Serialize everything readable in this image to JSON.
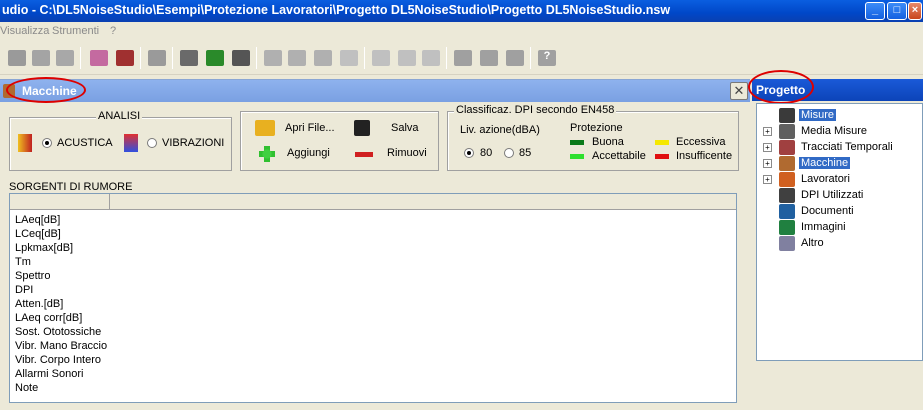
{
  "window": {
    "title": "udio - C:\\DL5NoiseStudio\\Esempi\\Protezione Lavoratori\\Progetto DL5NoiseStudio\\Progetto DL5NoiseStudio.nsw"
  },
  "menu": [
    "Visualizza",
    "Strumenti",
    "?"
  ],
  "macchine": {
    "title": "Macchine",
    "close": "✕",
    "analisi": {
      "label": "ANALISI",
      "acustica": "ACUSTICA",
      "vibrazioni": "VIBRAZIONI",
      "selected": "ACUSTICA"
    },
    "actions": {
      "apri": "Apri File...",
      "salva": "Salva",
      "aggiungi": "Aggiungi",
      "rimuovi": "Rimuovi"
    },
    "dpi": {
      "label": "Classificaz. DPI secondo EN458",
      "liv_label": "Liv. azione(dBA)",
      "opt80": "80",
      "opt85": "85",
      "selected": "80",
      "protezione_label": "Protezione",
      "buona": "Buona",
      "accettabile": "Accettabile",
      "eccessiva": "Eccessiva",
      "insufficente": "Insufficente",
      "colors": {
        "buona": "#0a7a1a",
        "accettabile": "#2ee02e",
        "eccessiva": "#f5e800",
        "insufficente": "#e01010"
      }
    },
    "sorgenti": {
      "label": "SORGENTI DI RUMORE",
      "rows": [
        "LAeq[dB]",
        "LCeq[dB]",
        "Lpkmax[dB]",
        "Tm",
        "Spettro",
        "DPI",
        "Atten.[dB]",
        "LAeq corr[dB]",
        "Sost. Ototossiche",
        "Vibr. Mano Braccio",
        "Vibr. Corpo Intero",
        "Allarmi Sonori",
        "Note"
      ]
    }
  },
  "progetto": {
    "title": "Progetto",
    "items": [
      {
        "label": "Misure",
        "icon": "microphone-icon",
        "expandable": false,
        "selected": true
      },
      {
        "label": "Media Misure",
        "icon": "grid-icon",
        "expandable": true,
        "selected": false
      },
      {
        "label": "Tracciati Temporali",
        "icon": "graph-icon",
        "expandable": true,
        "selected": false
      },
      {
        "label": "Macchine",
        "icon": "machine-icon",
        "expandable": true,
        "selected": true
      },
      {
        "label": "Lavoratori",
        "icon": "worker-icon",
        "expandable": true,
        "selected": false
      },
      {
        "label": "DPI Utilizzati",
        "icon": "earmuff-icon",
        "expandable": false,
        "selected": false
      },
      {
        "label": "Documenti",
        "icon": "document-icon",
        "expandable": false,
        "selected": false
      },
      {
        "label": "Immagini",
        "icon": "image-icon",
        "expandable": false,
        "selected": false
      },
      {
        "label": "Altro",
        "icon": "other-icon",
        "expandable": false,
        "selected": false
      }
    ]
  }
}
